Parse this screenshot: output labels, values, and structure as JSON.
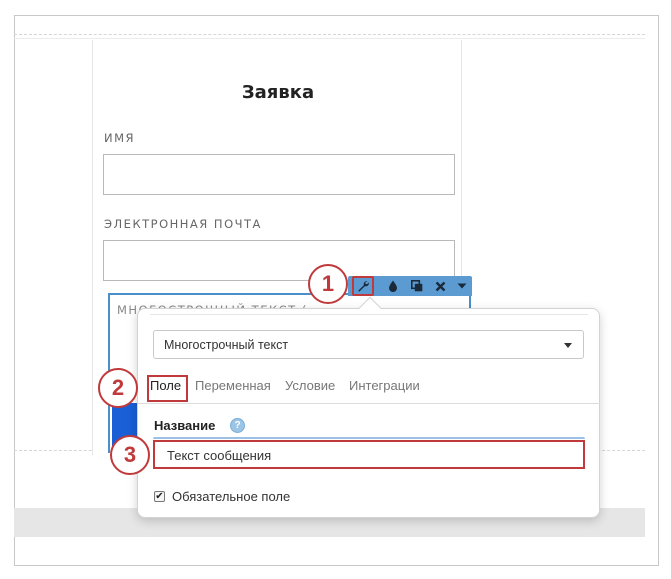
{
  "form": {
    "title": "Заявка",
    "fields": [
      {
        "label": "ИМЯ"
      },
      {
        "label": "ЭЛЕКТРОННАЯ ПОЧТА"
      },
      {
        "label": "МНОГОСТРОЧНЫЙ ТЕКСТ ("
      }
    ]
  },
  "toolbar": {
    "icons": [
      "wrench-icon",
      "drop-icon",
      "copy-icon",
      "close-icon",
      "caret-down-icon"
    ]
  },
  "popup": {
    "field_type": "Многострочный текст",
    "tabs": [
      {
        "label": "Поле",
        "active": true
      },
      {
        "label": "Переменная",
        "active": false
      },
      {
        "label": "Условие",
        "active": false
      },
      {
        "label": "Интеграции",
        "active": false
      }
    ],
    "name_label": "Название",
    "help_glyph": "?",
    "name_value": "Текст сообщения",
    "required_label": "Обязательное поле",
    "required_checked": true,
    "check_glyph": "✔"
  },
  "annotations": [
    "1",
    "2",
    "3"
  ],
  "colors": {
    "accent": "#5b9bd1",
    "highlight": "#c0393b",
    "selected_border": "#4a8fc7"
  }
}
